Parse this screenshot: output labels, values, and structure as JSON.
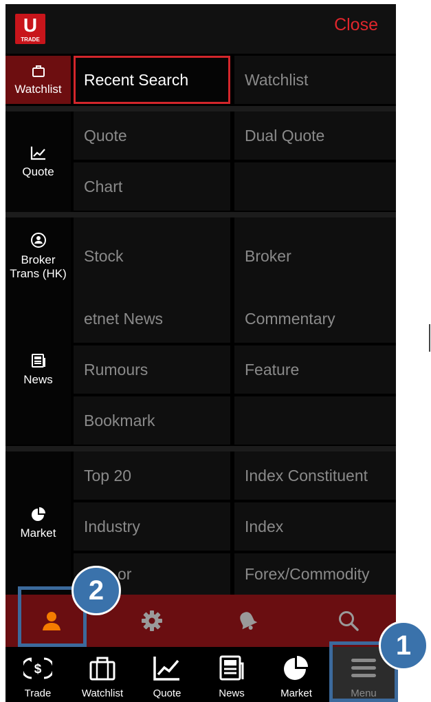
{
  "header": {
    "logo_letter": "U",
    "logo_text": "TRADE",
    "close_label": "Close"
  },
  "sections": {
    "watchlist": {
      "label": "Watchlist",
      "icon": "briefcase-icon"
    },
    "quote": {
      "label": "Quote",
      "icon": "line-chart-icon"
    },
    "broker": {
      "label": "Broker\nTrans (HK)",
      "icon": "broker-icon"
    },
    "news": {
      "label": "News",
      "icon": "newspaper-icon"
    },
    "market": {
      "label": "Market",
      "icon": "pie-chart-icon"
    }
  },
  "items": {
    "recent_search": "Recent Search",
    "watchlist": "Watchlist",
    "quote": "Quote",
    "dual_quote": "Dual Quote",
    "chart": "Chart",
    "stock": "Stock",
    "broker": "Broker",
    "etnet_news": "etnet News",
    "commentary": "Commentary",
    "rumours": "Rumours",
    "feature": "Feature",
    "bookmark": "Bookmark",
    "top20": "Top 20",
    "index_constituent": "Index Constituent",
    "industry": "Industry",
    "index": "Index",
    "sector_partial": "or",
    "forex": "Forex/Commodity"
  },
  "quickbar": [
    "user-icon",
    "gear-icon",
    "bell-icon",
    "search-icon"
  ],
  "tabs": {
    "trade": "Trade",
    "watchlist": "Watchlist",
    "quote": "Quote",
    "news": "News",
    "market": "Market",
    "menu": "Menu"
  },
  "badges": {
    "one": "1",
    "two": "2"
  },
  "colors": {
    "accent": "#c8151b",
    "quickbar": "#6a0e11",
    "annotation": "#3a72ab"
  }
}
